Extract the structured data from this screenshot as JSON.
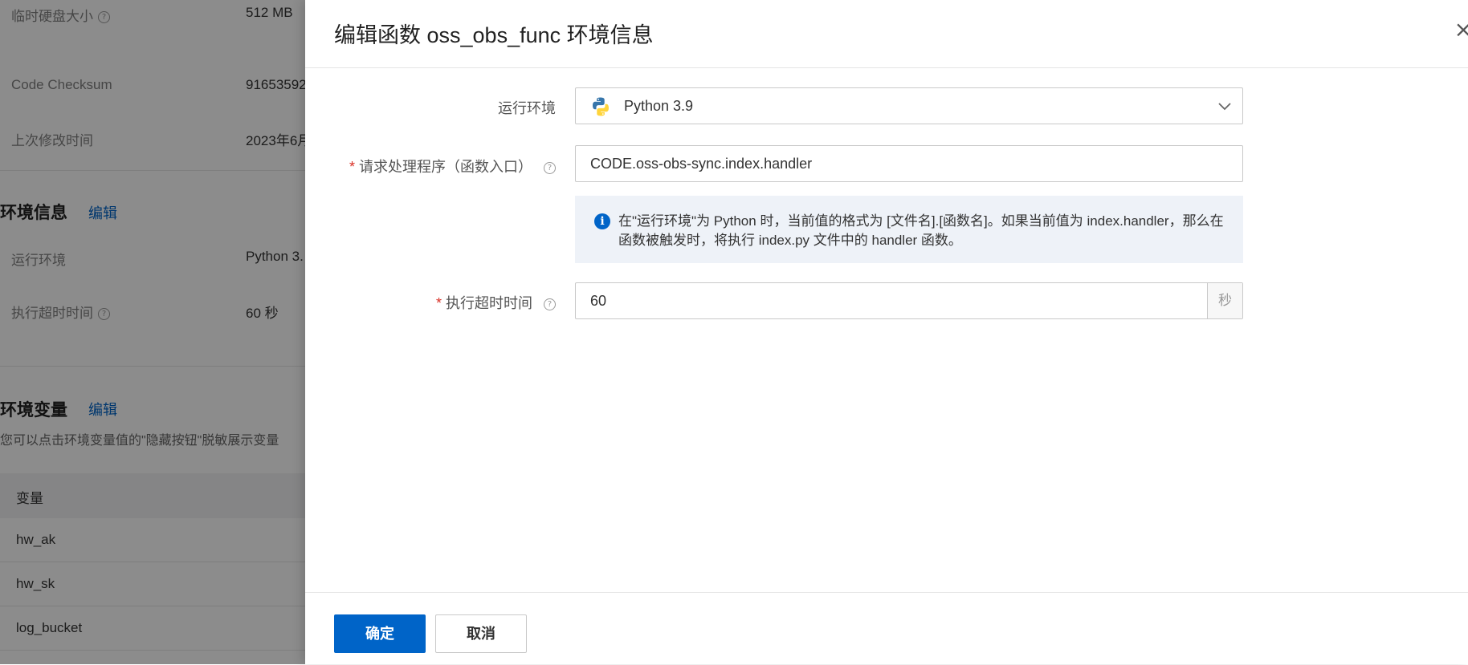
{
  "background": {
    "rows": [
      {
        "label": "临时硬盘大小",
        "value": "512 MB",
        "help": true
      },
      {
        "label": "Code Checksum",
        "value": "91653592",
        "help": false
      },
      {
        "label": "上次修改时间",
        "value": "2023年6月",
        "help": false
      }
    ],
    "env_section": {
      "title": "环境信息",
      "edit": "编辑",
      "rows": [
        {
          "label": "运行环境",
          "value": "Python 3.",
          "help": false
        },
        {
          "label": "执行超时时间",
          "value": "60 秒",
          "help": true
        }
      ]
    },
    "vars_section": {
      "title": "环境变量",
      "edit": "编辑",
      "desc": "您可以点击环境变量值的\"隐藏按钮\"脱敏展示变量",
      "table_header": "变量",
      "rows": [
        "hw_ak",
        "hw_sk",
        "log_bucket"
      ]
    }
  },
  "drawer": {
    "title": "编辑函数 oss_obs_func 环境信息",
    "close": "×",
    "fields": {
      "runtime": {
        "label": "运行环境",
        "value": "Python 3.9"
      },
      "handler": {
        "label": "请求处理程序（函数入口）",
        "value": "CODE.oss-obs-sync.index.handler",
        "required": "*"
      },
      "info": "在\"运行环境\"为 Python 时，当前值的格式为 [文件名].[函数名]。如果当前值为 index.handler，那么在函数被触发时，将执行 index.py 文件中的 handler 函数。",
      "timeout": {
        "label": "执行超时时间",
        "value": "60",
        "unit": "秒",
        "required": "*"
      }
    },
    "footer": {
      "confirm": "确定",
      "cancel": "取消"
    }
  },
  "colors": {
    "primary": "#0064c8",
    "required": "#d93026",
    "overlay": "rgba(0,0,0,0.45)"
  }
}
